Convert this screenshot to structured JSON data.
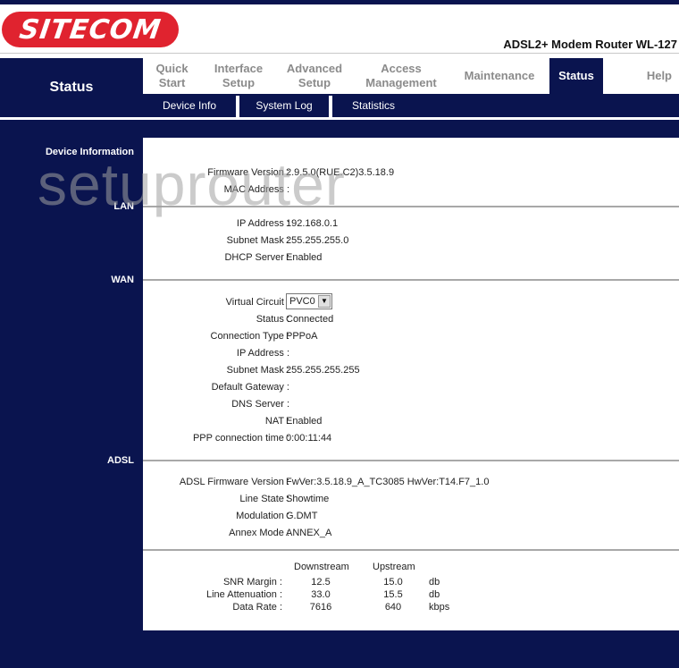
{
  "brand": {
    "logo_text": "SITECOM",
    "model": "ADSL2+ Modem Router WL-127",
    "logo_color": "#e0232f",
    "navy": "#0a144f"
  },
  "section_title": "Status",
  "main_nav": [
    {
      "label": "Quick\nStart",
      "l1": "Quick",
      "l2": "Start",
      "active": false
    },
    {
      "label": "Interface Setup",
      "l1": "Interface",
      "l2": "Setup",
      "active": false
    },
    {
      "label": "Advanced Setup",
      "l1": "Advanced",
      "l2": "Setup",
      "active": false
    },
    {
      "label": "Access Management",
      "l1": "Access",
      "l2": "Management",
      "active": false
    },
    {
      "label": "Maintenance",
      "l1": "Maintenance",
      "l2": "",
      "active": false
    },
    {
      "label": "Status",
      "l1": "Status",
      "l2": "",
      "active": true
    },
    {
      "label": "Help",
      "l1": "Help",
      "l2": "",
      "active": false
    }
  ],
  "sub_nav": [
    "Device Info",
    "System Log",
    "Statistics"
  ],
  "watermark": "setuprouter",
  "sections": {
    "device": {
      "title": "Device Information",
      "rows": [
        {
          "label": "Firmware Version :",
          "value": "2.9.5.0(RUE.C2)3.5.18.9"
        },
        {
          "label": "MAC Address :",
          "value": ""
        }
      ]
    },
    "lan": {
      "title": "LAN",
      "rows": [
        {
          "label": "IP Address :",
          "value": "192.168.0.1"
        },
        {
          "label": "Subnet Mask :",
          "value": "255.255.255.0"
        },
        {
          "label": "DHCP Server :",
          "value": "Enabled"
        }
      ]
    },
    "wan": {
      "title": "WAN",
      "virtual_circuit": {
        "label": "Virtual Circuit :",
        "selected": "PVC0"
      },
      "rows": [
        {
          "label": "Status :",
          "value": "Connected"
        },
        {
          "label": "Connection Type :",
          "value": "PPPoA"
        },
        {
          "label": "IP Address :",
          "value": ""
        },
        {
          "label": "Subnet Mask :",
          "value": "255.255.255.255"
        },
        {
          "label": "Default Gateway :",
          "value": ""
        },
        {
          "label": "DNS Server :",
          "value": ""
        },
        {
          "label": "NAT :",
          "value": "Enabled"
        },
        {
          "label": "PPP connection time :",
          "value": "0:00:11:44"
        }
      ]
    },
    "adsl": {
      "title": "ADSL",
      "rows": [
        {
          "label": "ADSL Firmware Version :",
          "value": "FwVer:3.5.18.9_A_TC3085 HwVer:T14.F7_1.0"
        },
        {
          "label": "Line State :",
          "value": "Showtime"
        },
        {
          "label": "Modulation :",
          "value": "G.DMT"
        },
        {
          "label": "Annex Mode :",
          "value": "ANNEX_A"
        }
      ]
    },
    "stats": {
      "headers": [
        "Downstream",
        "Upstream"
      ],
      "rows": [
        {
          "label": "SNR Margin :",
          "down": "12.5",
          "up": "15.0",
          "unit": "db"
        },
        {
          "label": "Line Attenuation :",
          "down": "33.0",
          "up": "15.5",
          "unit": "db"
        },
        {
          "label": "Data Rate :",
          "down": "7616",
          "up": "640",
          "unit": "kbps"
        }
      ]
    }
  }
}
